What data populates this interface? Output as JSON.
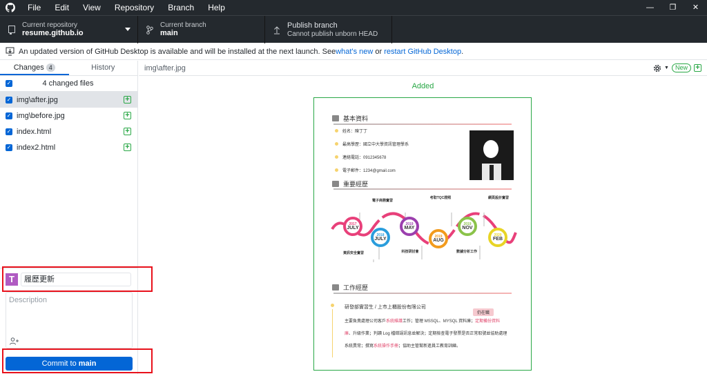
{
  "menu": {
    "items": [
      "File",
      "Edit",
      "View",
      "Repository",
      "Branch",
      "Help"
    ]
  },
  "toolbar": {
    "repo": {
      "caption": "Current repository",
      "value": "resume.github.io"
    },
    "branch": {
      "caption": "Current branch",
      "value": "main"
    },
    "publish": {
      "caption": "Publish branch",
      "value": "Cannot publish unborn HEAD"
    }
  },
  "banner": {
    "text": "An updated version of GitHub Desktop is available and will be installed at the next launch. See ",
    "link1": "what's new",
    "mid": " or ",
    "link2": "restart GitHub Desktop",
    "end": "."
  },
  "tabs": {
    "changes": "Changes",
    "changes_count": "4",
    "history": "History"
  },
  "changes": {
    "summary": "4 changed files",
    "files": [
      "img\\after.jpg",
      "img\\before.jpg",
      "index.html",
      "index2.html"
    ]
  },
  "commit": {
    "avatar": "T",
    "summary": "履歷更新",
    "description_placeholder": "Description",
    "coauthor_icon": "add-coauthor-icon",
    "button_prefix": "Commit to ",
    "button_branch": "main"
  },
  "diff": {
    "path": "img\\after.jpg",
    "new_label": "New",
    "status": "Added"
  },
  "resume": {
    "section1": "基本資料",
    "name": "姓名：陳丁丁",
    "edu": "最高學歷：國立中大學資訊管理學系",
    "phone": "連絡電話：0912345678",
    "email": "電子郵件：1234@gmail.com",
    "section2": "重要經歷",
    "timeline": [
      {
        "year": "2017",
        "month": "JULY",
        "color": "#e8407a"
      },
      {
        "year": "2018",
        "month": "JULY",
        "color": "#2a9ddc"
      },
      {
        "year": "2019",
        "month": "MAY",
        "color": "#9b3fae"
      },
      {
        "year": "2019",
        "month": "AUG",
        "color": "#f29b1d"
      },
      {
        "year": "2019",
        "month": "NOV",
        "color": "#8bc34a"
      },
      {
        "year": "2020",
        "month": "FEB",
        "color": "#e8d425"
      }
    ],
    "notes_top": [
      "電子商務實習",
      "考取TQC證照",
      "網頁設計實習"
    ],
    "notes_bottom": [
      "資訊安全實習",
      "科技研討會",
      "數據分析工作"
    ],
    "section3": "工作經歷",
    "job": "研發部實習生 / 上市上櫃股份有限公司",
    "status": "仍在職",
    "line1a": "主要負責處理公司客戶",
    "line1b": "系統維護",
    "line1c": "工作；管理 MSSQL、MYSQL 資料庫；",
    "line1d": "定期備份資料",
    "line2a": "庫",
    "line2b": "、升級作業；判讀 Log 檔錯誤訊息並解決；定期檢查電子發票是否正常取號並協助處理",
    "line3a": "系統異常；撰寫",
    "line3b": "系統操作手冊",
    "line3c": "；協助主管幫新進員工教育訓練。"
  }
}
